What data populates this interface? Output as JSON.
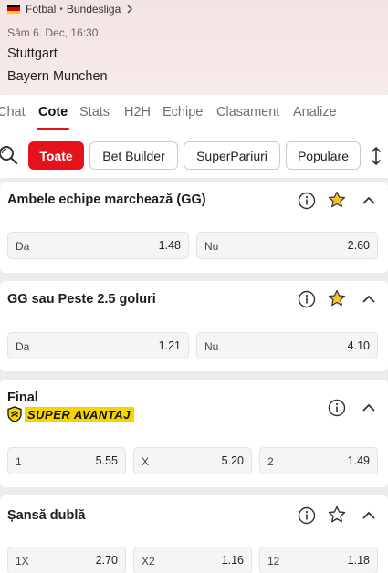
{
  "header": {
    "sport": "Fotbal",
    "league": "Bundesliga",
    "date": "Sâm 6. Dec, 16:30",
    "team_home": "Stuttgart",
    "team_away": "Bayern Munchen"
  },
  "tabs": [
    {
      "label": "Chat"
    },
    {
      "label": "Cote",
      "active": true
    },
    {
      "label": "Stats"
    },
    {
      "label": "H2H"
    },
    {
      "label": "Echipe"
    },
    {
      "label": "Clasament"
    },
    {
      "label": "Analize"
    }
  ],
  "filters": [
    {
      "label": "Toate",
      "active": true
    },
    {
      "label": "Bet Builder"
    },
    {
      "label": "SuperPariuri"
    },
    {
      "label": "Populare"
    }
  ],
  "markets": [
    {
      "title": "Ambele echipe marchează (GG)",
      "favorite": true,
      "odds": [
        {
          "label": "Da",
          "value": "1.48"
        },
        {
          "label": "Nu",
          "value": "2.60"
        }
      ]
    },
    {
      "title": "GG sau Peste 2.5 goluri",
      "favorite": true,
      "odds": [
        {
          "label": "Da",
          "value": "1.21"
        },
        {
          "label": "Nu",
          "value": "4.10"
        }
      ]
    },
    {
      "title": "Final",
      "badge": "SUPER AVANTAJ",
      "favorite": false,
      "odds": [
        {
          "label": "1",
          "value": "5.55"
        },
        {
          "label": "X",
          "value": "5.20"
        },
        {
          "label": "2",
          "value": "1.49"
        }
      ]
    },
    {
      "title": "Șansă dublă",
      "favorite": false,
      "odds": [
        {
          "label": "1X",
          "value": "2.70"
        },
        {
          "label": "X2",
          "value": "1.16"
        },
        {
          "label": "12",
          "value": "1.18"
        }
      ]
    }
  ],
  "colors": {
    "accent": "#e4121a",
    "favorite_star": "#f2c230",
    "badge_bg": "#f5d400"
  },
  "icons": [
    "germany-flag-icon",
    "chevron-right-icon",
    "search-icon",
    "sort-icon",
    "info-icon",
    "star-icon",
    "chevron-up-icon",
    "super-avantaj-shield-icon"
  ]
}
